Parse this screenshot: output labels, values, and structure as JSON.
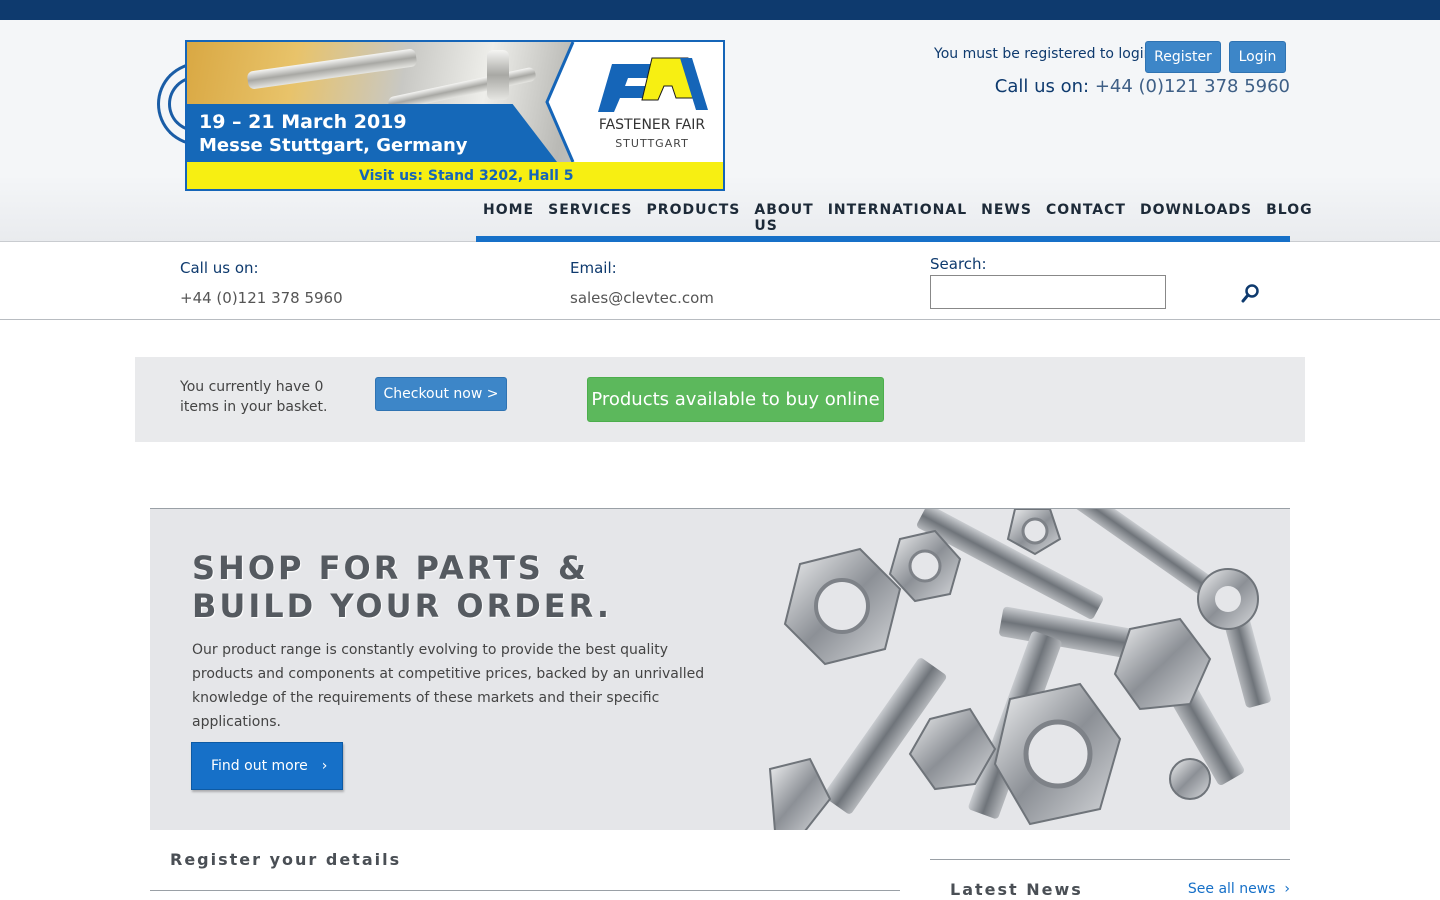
{
  "header": {
    "login_message": "You must be registered to login.",
    "register_label": "Register",
    "login_label": "Login",
    "call_label": "Call us on:",
    "call_number": "+44 (0)121 378 5960"
  },
  "banner": {
    "dates": "19 – 21 March 2019",
    "venue": "Messe Stuttgart, Germany",
    "fair_name": "FASTENER FAIR",
    "fair_city": "STUTTGART",
    "visit": "Visit us: Stand 3202, Hall 5"
  },
  "nav": {
    "items": [
      "HOME",
      "SERVICES",
      "PRODUCTS",
      "ABOUT US",
      "INTERNATIONAL",
      "NEWS",
      "CONTACT",
      "DOWNLOADS",
      "BLOG"
    ]
  },
  "info": {
    "call_label": "Call us on:",
    "call_value": "+44 (0)121 378 5960",
    "email_label": "Email:",
    "email_value": "sales@clevtec.com",
    "search_label": "Search:",
    "search_value": ""
  },
  "basket": {
    "text": "You currently have 0 items in your basket.",
    "checkout_label": "Checkout now >",
    "products_label": "Products available to buy online"
  },
  "hero": {
    "title_line1": "SHOP FOR PARTS &",
    "title_line2": "BUILD YOUR ORDER.",
    "text": "Our product range is constantly evolving to provide the best quality products and components at competitive prices, backed by an unrivalled knowledge of the requirements of these markets and their specific applications.",
    "button_label": "Find out more"
  },
  "sections": {
    "register_title": "Register your details",
    "news_title": "Latest News",
    "news_link": "See all news"
  },
  "colors": {
    "topbar": "#0e3a6e",
    "accent_blue": "#1670c8",
    "button_blue": "#3d86c8",
    "green": "#5cb85c",
    "banner_yellow": "#f7ef12"
  }
}
